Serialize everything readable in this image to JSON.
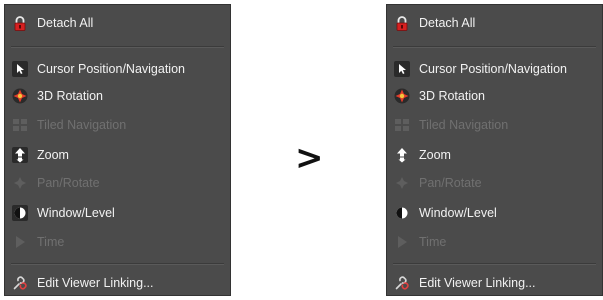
{
  "menu": {
    "detach_all": "Detach All",
    "cursor_position": "Cursor Position/Navigation",
    "rotation_3d": "3D Rotation",
    "tiled_navigation": "Tiled Navigation",
    "zoom": "Zoom",
    "pan_rotate": "Pan/Rotate",
    "window_level": "Window/Level",
    "time": "Time",
    "edit_viewer_linking": "Edit Viewer Linking..."
  },
  "transition_symbol": ">",
  "colors": {
    "panel_bg": "#4b4b4b",
    "text": "#f2f2f2",
    "disabled_text": "#707070",
    "lock_red": "#d62020"
  },
  "icons": [
    "lock-icon",
    "cursor-icon",
    "rotation-3d-icon",
    "tiled-icon",
    "zoom-icon",
    "pan-rotate-icon",
    "window-level-icon",
    "time-icon",
    "link-icon"
  ]
}
